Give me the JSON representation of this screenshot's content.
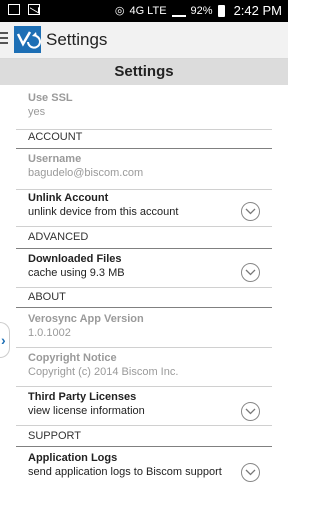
{
  "status_bar": {
    "network": "4G LTE",
    "battery": "92%",
    "time": "2:42 PM"
  },
  "action_bar": {
    "app_title": "Settings"
  },
  "page_header": {
    "title": "Settings"
  },
  "rows": [
    {
      "title": "Use SSL",
      "subtitle": "yes",
      "enabled": false
    },
    {
      "section": "ACCOUNT"
    },
    {
      "title": "Username",
      "subtitle": "bagudelo@biscom.com",
      "enabled": false
    },
    {
      "title": "Unlink Account",
      "subtitle": "unlink device from this account",
      "enabled": true,
      "chevron": true
    },
    {
      "section": "ADVANCED"
    },
    {
      "title": "Downloaded Files",
      "subtitle": "cache using 9.3 MB",
      "enabled": true,
      "chevron": true
    },
    {
      "section": "ABOUT"
    },
    {
      "title": "Verosync App Version",
      "subtitle": "1.0.1002",
      "enabled": false
    },
    {
      "title": "Copyright Notice",
      "subtitle": "Copyright (c) 2014 Biscom Inc.",
      "enabled": false
    },
    {
      "title": "Third Party Licenses",
      "subtitle": "view license information",
      "enabled": true,
      "chevron": true
    },
    {
      "section": "SUPPORT"
    },
    {
      "title": "Application Logs",
      "subtitle": "send application logs to Biscom support",
      "enabled": true,
      "chevron": true
    }
  ],
  "drawer_handle": {
    "glyph": "›"
  },
  "colors": {
    "brand": "#1d6fb5",
    "header_bg": "#dcdcdc"
  }
}
